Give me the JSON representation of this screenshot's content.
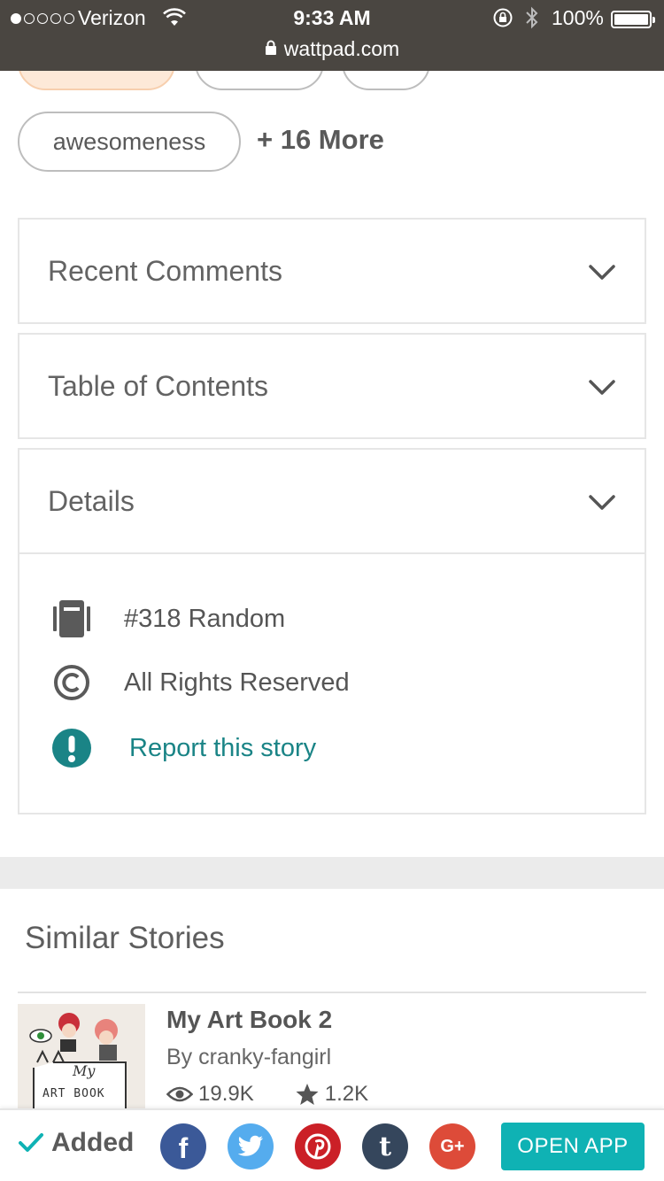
{
  "status_bar": {
    "carrier": "Verizon",
    "time": "9:33 AM",
    "battery": "100%",
    "url": "wattpad.com",
    "signal_strength": 1,
    "icons": [
      "wifi-icon",
      "rotation-lock-icon",
      "bluetooth-icon",
      "battery-icon",
      "padlock-icon"
    ]
  },
  "tags": {
    "visible_tag": "awesomeness",
    "more_label": "+ 16 More"
  },
  "sections": {
    "recent_comments": "Recent Comments",
    "table_of_contents": "Table of Contents",
    "details": "Details"
  },
  "details": {
    "rank": "#318 Random",
    "copyright": "All Rights Reserved",
    "report": "Report this story",
    "icons": [
      "book-icon",
      "copyright-icon",
      "exclamation-icon",
      "chevron-down-icon"
    ]
  },
  "similar": {
    "title": "Similar Stories",
    "story": {
      "title": "My Art Book 2",
      "author": "By cranky-fangirl",
      "reads": "19.9K",
      "votes": "1.2K",
      "cover_text_1": "My",
      "cover_text_2": "ART BOOK"
    }
  },
  "bottom_bar": {
    "added_label": "Added",
    "open_app": "OPEN APP",
    "share_networks": [
      "facebook",
      "twitter",
      "pinterest",
      "tumblr",
      "google-plus"
    ],
    "share_glyphs": {
      "facebook": "f",
      "tumblr": "t",
      "google_plus": "G+"
    }
  },
  "colors": {
    "status_bar_bg": "#4a4641",
    "accent_teal": "#1a8486",
    "open_app_bg": "#0fb2b4",
    "facebook": "#3b5998",
    "twitter": "#55acee",
    "pinterest": "#cb2027",
    "tumblr": "#35465c",
    "google_plus": "#dd4b39"
  }
}
